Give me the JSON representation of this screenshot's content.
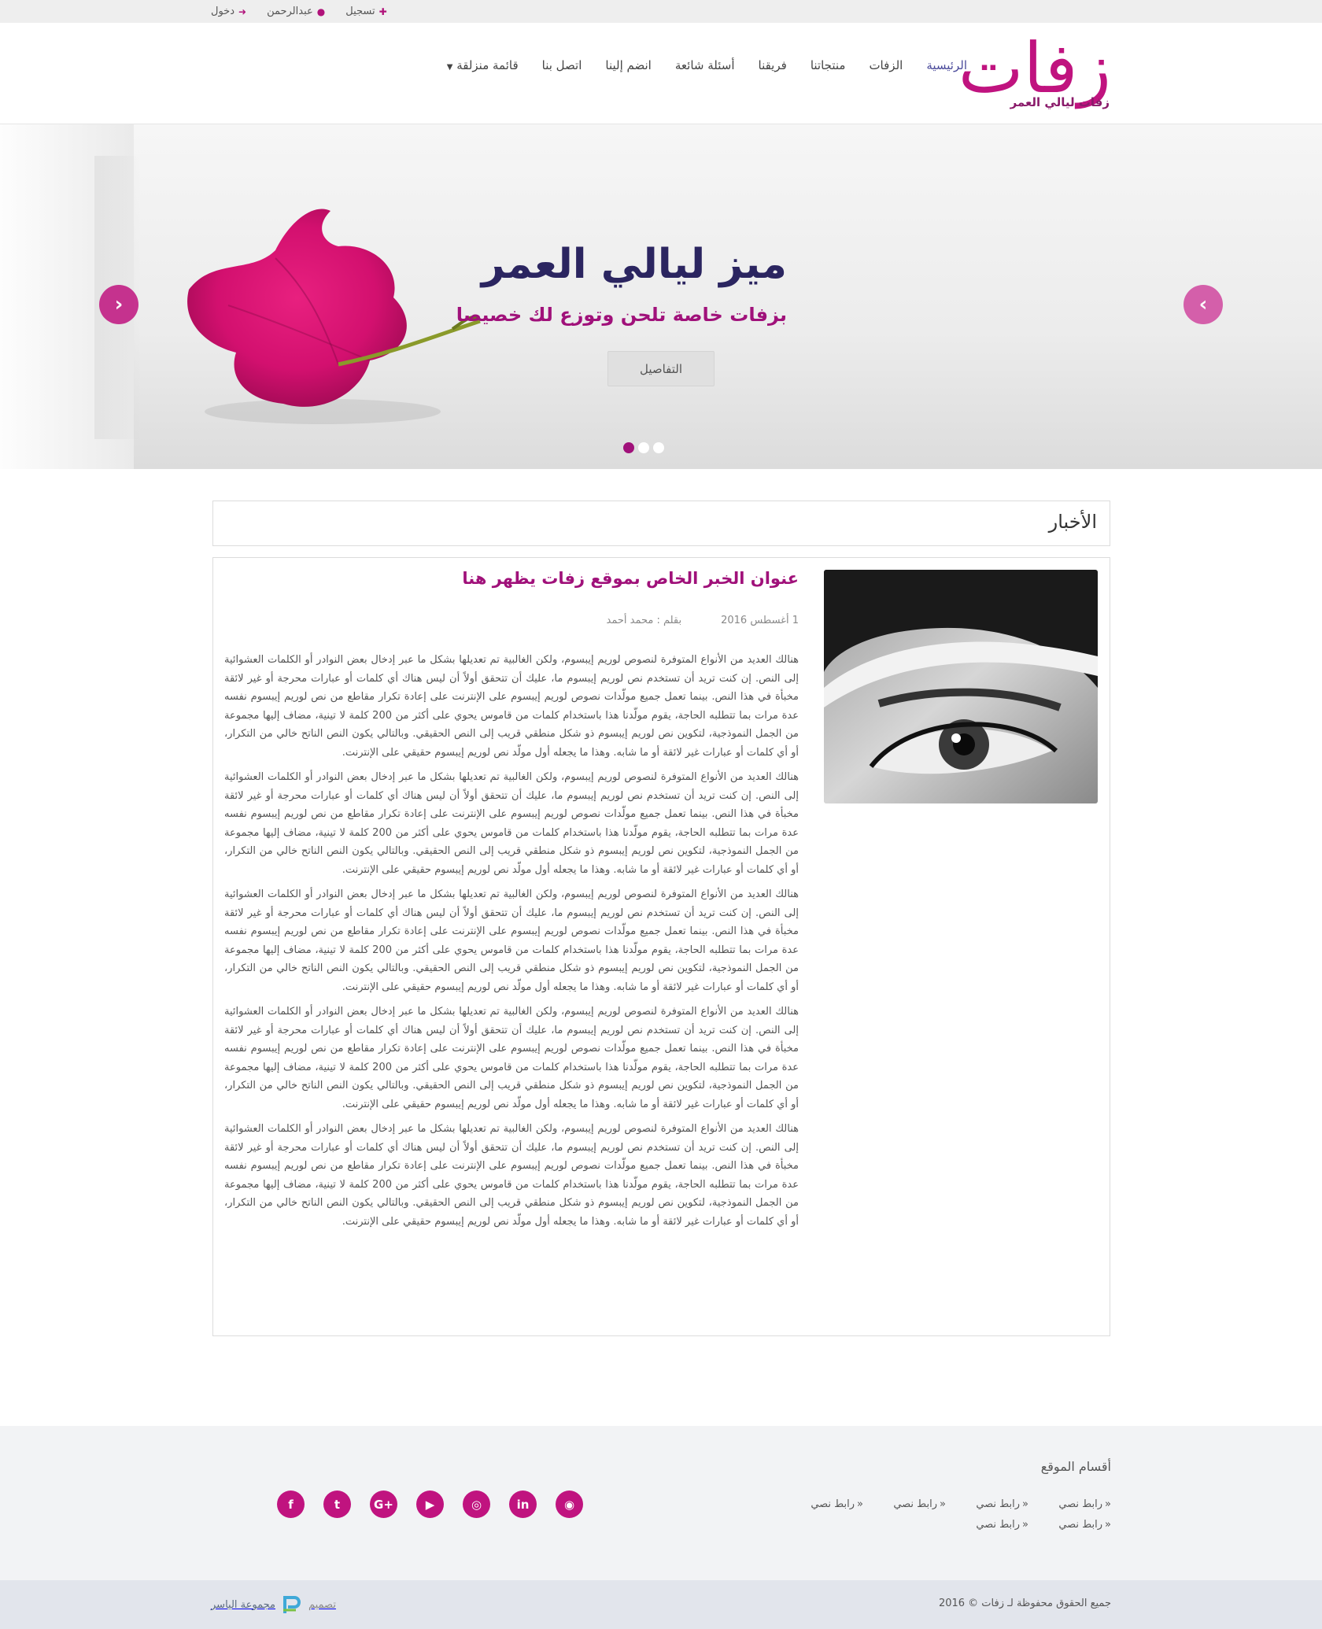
{
  "topbar": {
    "login": "دخول",
    "user": "عبدالرحمن",
    "register": "تسجيل"
  },
  "logo": {
    "main": "زفات",
    "tagline": "زفات ليالي العمر"
  },
  "nav": {
    "items": [
      "الرئيسية",
      "الزفات",
      "منتجاتنا",
      "فريقنا",
      "أسئلة شائعة",
      "انضم إلينا",
      "اتصل بنا"
    ],
    "dropdown": "قائمة منزلقة"
  },
  "hero": {
    "title": "ميز ليالي العمر",
    "subtitle": "بزفات خاصة تلحن وتوزع لك خصيصا",
    "button": "التفاصيل"
  },
  "news": {
    "heading": "الأخبار",
    "article": {
      "title": "عنوان الخبر الخاص بموقع زفات يظهر هنا",
      "date": "1 أغسطس 2016",
      "author": "بقلم : محمد أحمد",
      "paragraphs": [
        "هنالك العديد من الأنواع المتوفرة لنصوص لوريم إيبسوم، ولكن الغالبية تم تعديلها بشكل ما عبر إدخال بعض النوادر أو الكلمات العشوائية إلى النص. إن كنت تريد أن تستخدم نص لوريم إيبسوم ما، عليك أن تتحقق أولاً أن ليس هناك أي كلمات أو عبارات محرجة أو غير لائقة مخبأة في هذا النص. بينما تعمل جميع مولّدات نصوص لوريم إيبسوم على الإنترنت على إعادة تكرار مقاطع من نص لوريم إيبسوم نفسه عدة مرات بما تتطلبه الحاجة، يقوم مولّدنا هذا باستخدام كلمات من قاموس يحوي على أكثر من 200 كلمة لا تينية، مضاف إليها مجموعة من الجمل النموذجية، لتكوين نص لوريم إيبسوم ذو شكل منطقي قريب إلى النص الحقيقي. وبالتالي يكون النص الناتح خالي من التكرار، أو أي كلمات أو عبارات غير لائقة أو ما شابه. وهذا ما يجعله أول مولّد نص لوريم إيبسوم حقيقي على الإنترنت.",
        "هنالك العديد من الأنواع المتوفرة لنصوص لوريم إيبسوم، ولكن الغالبية تم تعديلها بشكل ما عبر إدخال بعض النوادر أو الكلمات العشوائية إلى النص. إن كنت تريد أن تستخدم نص لوريم إيبسوم ما، عليك أن تتحقق أولاً أن ليس هناك أي كلمات أو عبارات محرجة أو غير لائقة مخبأة في هذا النص. بينما تعمل جميع مولّدات نصوص لوريم إيبسوم على الإنترنت على إعادة تكرار مقاطع من نص لوريم إيبسوم نفسه عدة مرات بما تتطلبه الحاجة، يقوم مولّدنا هذا باستخدام كلمات من قاموس يحوي على أكثر من 200 كلمة لا تينية، مضاف إليها مجموعة من الجمل النموذجية، لتكوين نص لوريم إيبسوم ذو شكل منطقي قريب إلى النص الحقيقي. وبالتالي يكون النص الناتح خالي من التكرار، أو أي كلمات أو عبارات غير لائقة أو ما شابه. وهذا ما يجعله أول مولّد نص لوريم إيبسوم حقيقي على الإنترنت.",
        "هنالك العديد من الأنواع المتوفرة لنصوص لوريم إيبسوم، ولكن الغالبية تم تعديلها بشكل ما عبر إدخال بعض النوادر أو الكلمات العشوائية إلى النص. إن كنت تريد أن تستخدم نص لوريم إيبسوم ما، عليك أن تتحقق أولاً أن ليس هناك أي كلمات أو عبارات محرجة أو غير لائقة مخبأة في هذا النص. بينما تعمل جميع مولّدات نصوص لوريم إيبسوم على الإنترنت على إعادة تكرار مقاطع من نص لوريم إيبسوم نفسه عدة مرات بما تتطلبه الحاجة، يقوم مولّدنا هذا باستخدام كلمات من قاموس يحوي على أكثر من 200 كلمة لا تينية، مضاف إليها مجموعة من الجمل النموذجية، لتكوين نص لوريم إيبسوم ذو شكل منطقي قريب إلى النص الحقيقي. وبالتالي يكون النص الناتح خالي من التكرار، أو أي كلمات أو عبارات غير لائقة أو ما شابه. وهذا ما يجعله أول مولّد نص لوريم إيبسوم حقيقي على الإنترنت.",
        "هنالك العديد من الأنواع المتوفرة لنصوص لوريم إيبسوم، ولكن الغالبية تم تعديلها بشكل ما عبر إدخال بعض النوادر أو الكلمات العشوائية إلى النص. إن كنت تريد أن تستخدم نص لوريم إيبسوم ما، عليك أن تتحقق أولاً أن ليس هناك أي كلمات أو عبارات محرجة أو غير لائقة مخبأة في هذا النص. بينما تعمل جميع مولّدات نصوص لوريم إيبسوم على الإنترنت على إعادة تكرار مقاطع من نص لوريم إيبسوم نفسه عدة مرات بما تتطلبه الحاجة، يقوم مولّدنا هذا باستخدام كلمات من قاموس يحوي على أكثر من 200 كلمة لا تينية، مضاف إليها مجموعة من الجمل النموذجية، لتكوين نص لوريم إيبسوم ذو شكل منطقي قريب إلى النص الحقيقي. وبالتالي يكون النص الناتح خالي من التكرار، أو أي كلمات أو عبارات غير لائقة أو ما شابه. وهذا ما يجعله أول مولّد نص لوريم إيبسوم حقيقي على الإنترنت.",
        "هنالك العديد من الأنواع المتوفرة لنصوص لوريم إيبسوم، ولكن الغالبية تم تعديلها بشكل ما عبر إدخال بعض النوادر أو الكلمات العشوائية إلى النص. إن كنت تريد أن تستخدم نص لوريم إيبسوم ما، عليك أن تتحقق أولاً أن ليس هناك أي كلمات أو عبارات محرجة أو غير لائقة مخبأة في هذا النص. بينما تعمل جميع مولّدات نصوص لوريم إيبسوم على الإنترنت على إعادة تكرار مقاطع من نص لوريم إيبسوم نفسه عدة مرات بما تتطلبه الحاجة، يقوم مولّدنا هذا باستخدام كلمات من قاموس يحوي على أكثر من 200 كلمة لا تينية، مضاف إليها مجموعة من الجمل النموذجية، لتكوين نص لوريم إيبسوم ذو شكل منطقي قريب إلى النص الحقيقي. وبالتالي يكون النص الناتح خالي من التكرار، أو أي كلمات أو عبارات غير لائقة أو ما شابه. وهذا ما يجعله أول مولّد نص لوريم إيبسوم حقيقي على الإنترنت."
      ]
    }
  },
  "footer": {
    "heading": "أقسام الموقع",
    "links": [
      "رابط نصي",
      "رابط نصي",
      "رابط نصي",
      "رابط نصي",
      "رابط نصي",
      "رابط نصي"
    ],
    "social": [
      "rss-icon",
      "linkedin-icon",
      "instagram-icon",
      "youtube-icon",
      "google-plus-icon",
      "twitter-icon",
      "facebook-icon"
    ],
    "copyright": "جميع الحقوق محفوظة لـ زفات © 2016",
    "credit_label": "تصميم",
    "credit_brand": "مجموعة الياسر"
  },
  "colors": {
    "brand": "#c0137f",
    "nav_active": "#4a4a9a",
    "hero_title": "#2b2560"
  }
}
